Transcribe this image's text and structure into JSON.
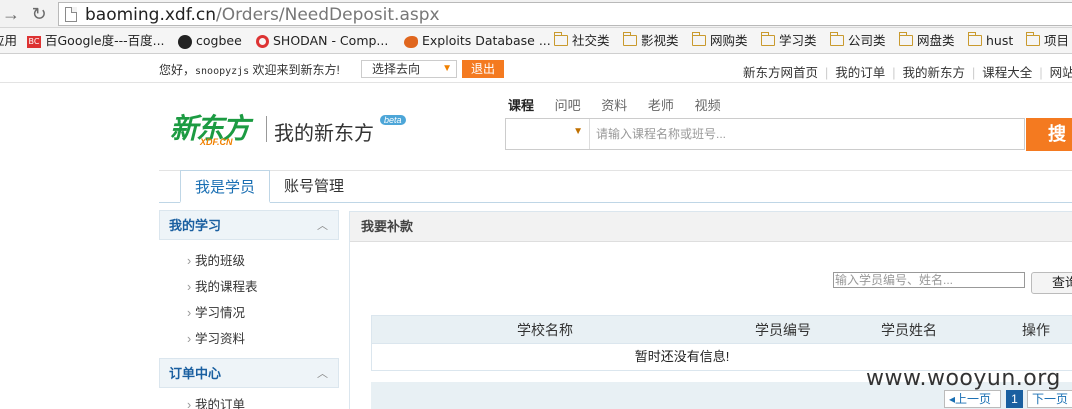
{
  "browser": {
    "url_host": "baoming.xdf.cn",
    "url_path": "/Orders/NeedDeposit.aspx",
    "bookmarks": [
      {
        "label": "应用",
        "icon": "apps-icon"
      },
      {
        "label": "百Google度---百度...",
        "icon": "bookmark-icon"
      },
      {
        "label": "cogbee",
        "icon": "github-icon"
      },
      {
        "label": "SHODAN - Comp...",
        "icon": "shodan-icon"
      },
      {
        "label": "Exploits Database ...",
        "icon": "exploit-db-icon"
      },
      {
        "label": "社交类",
        "icon": "folder-icon"
      },
      {
        "label": "影视类",
        "icon": "folder-icon"
      },
      {
        "label": "网购类",
        "icon": "folder-icon"
      },
      {
        "label": "学习类",
        "icon": "folder-icon"
      },
      {
        "label": "公司类",
        "icon": "folder-icon"
      },
      {
        "label": "网盘类",
        "icon": "folder-icon"
      },
      {
        "label": "hust",
        "icon": "folder-icon"
      },
      {
        "label": "项目",
        "icon": "folder-icon"
      }
    ]
  },
  "topbar": {
    "greeting_prefix": "您好，",
    "username": "snoopyzjs",
    "greeting_suffix": " 欢迎来到新东方!",
    "goto_select": "选择去向",
    "logout": "退出",
    "links": [
      "新东方网首页",
      "我的订单",
      "我的新东方",
      "课程大全",
      "网站"
    ]
  },
  "header": {
    "logo_main": "新东方",
    "logo_sub": "XDF.CN",
    "title": "我的新东方",
    "beta": "beta",
    "search_tabs": [
      "课程",
      "问吧",
      "资料",
      "老师",
      "视频"
    ],
    "search_placeholder": "请输入课程名称或班号...",
    "search_button": "搜"
  },
  "nav": {
    "tabs": [
      "我是学员",
      "账号管理"
    ]
  },
  "sidebar": {
    "sections": [
      {
        "title": "我的学习",
        "items": [
          "我的班级",
          "我的课程表",
          "学习情况",
          "学习资料"
        ]
      },
      {
        "title": "订单中心",
        "items": [
          "我的订单"
        ]
      }
    ]
  },
  "main": {
    "title": "我要补款",
    "query_placeholder": "输入学员编号、姓名...",
    "query_button": "查询",
    "columns": [
      "学校名称",
      "学员编号",
      "学员姓名",
      "操作"
    ],
    "empty_text": "暂时还没有信息!",
    "pager": {
      "prev": "上一页",
      "current": "1",
      "next": "下一页"
    }
  },
  "watermark": "www.wooyun.org",
  "colors": {
    "brand_green": "#1c9b42",
    "accent_orange": "#f47a20",
    "link_blue": "#1a6fb3"
  }
}
